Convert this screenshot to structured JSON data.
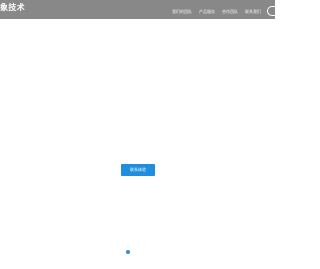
{
  "header": {
    "logo_text": "象技术",
    "nav_items": [
      {
        "label": "我们的团队"
      },
      {
        "label": "产品服务"
      },
      {
        "label": "合作团队"
      },
      {
        "label": "联系我们"
      }
    ],
    "search_icon": "search-icon"
  },
  "main": {
    "cta_label": "联系体验"
  },
  "carousel": {
    "indicator_icon": "dot-indicator-icon"
  },
  "colors": {
    "header_bg": "#888888",
    "button_bg": "#1f8de0",
    "indicator": "#2a8fd6"
  }
}
